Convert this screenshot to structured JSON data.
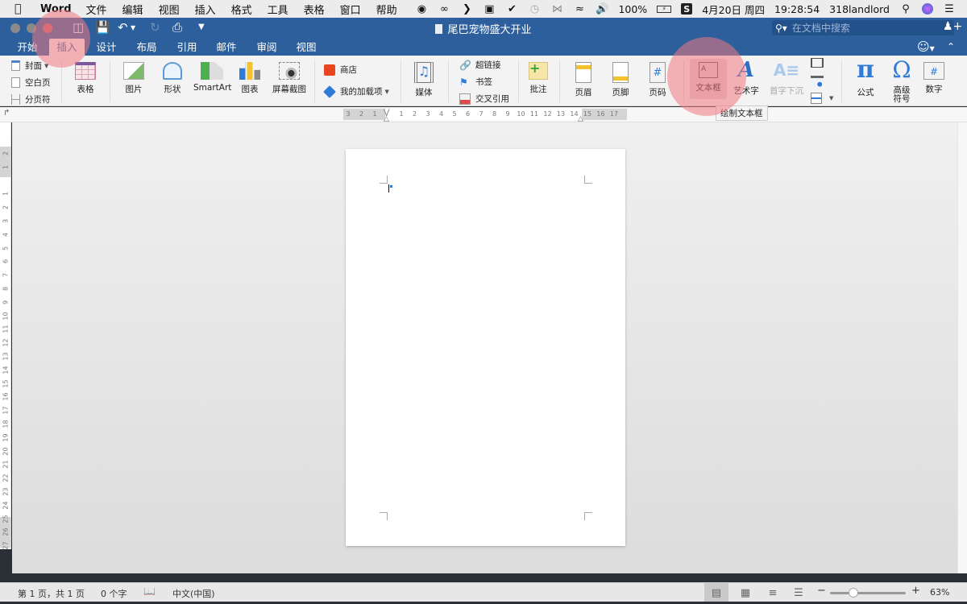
{
  "menubar": {
    "app_name": "Word",
    "menus": [
      "文件",
      "编辑",
      "视图",
      "插入",
      "格式",
      "工具",
      "表格",
      "窗口",
      "帮助"
    ],
    "status_icons": [
      "wechat-icon",
      "creative-cloud-icon",
      "evernote-icon",
      "airplay-icon",
      "checkmark-icon",
      "time-machine-icon",
      "bluetooth-icon",
      "wifi-icon",
      "volume-icon"
    ],
    "battery": "100%",
    "input_method": "S",
    "date": "4月20日 周四",
    "time": "19:28:54",
    "user": "318landlord"
  },
  "window": {
    "title": "尾巴宠物盛大开业",
    "search_placeholder": "在文档中搜索"
  },
  "tabs": [
    {
      "label": "开始"
    },
    {
      "label": "插入",
      "active": true
    },
    {
      "label": "设计"
    },
    {
      "label": "布局"
    },
    {
      "label": "引用"
    },
    {
      "label": "邮件"
    },
    {
      "label": "审阅"
    },
    {
      "label": "视图"
    }
  ],
  "ribbon": {
    "pages": {
      "cover": "封面",
      "blank": "空白页",
      "page_break": "分页符"
    },
    "table": "表格",
    "picture": "图片",
    "shapes": "形状",
    "smartart": "SmartArt",
    "chart": "图表",
    "screenshot": "屏幕截图",
    "store": "商店",
    "my_addins": "我的加载项",
    "media": "媒体",
    "hyperlink": "超链接",
    "bookmark": "书签",
    "cross_reference": "交叉引用",
    "comment": "批注",
    "header": "页眉",
    "footer": "页脚",
    "page_number": "页码",
    "text_box": "文本框",
    "wordart": "艺术字",
    "drop_cap": "首字下沉",
    "equation": "公式",
    "advanced_symbol_line1": "高级",
    "advanced_symbol_line2": "符号",
    "number": "数字",
    "equation_glyph": "π",
    "symbol_glyph": "Ω",
    "number_glyph": "#",
    "wordart_glyph": "A",
    "textbox_glyph": "A"
  },
  "tooltip": "绘制文本框",
  "ruler": {
    "horizontal": [
      "3",
      "2",
      "1",
      "",
      "1",
      "2",
      "3",
      "4",
      "5",
      "6",
      "7",
      "8",
      "9",
      "10",
      "11",
      "12",
      "13",
      "14",
      "15",
      "16",
      "17"
    ],
    "vertical": [
      "2",
      "1",
      "",
      "1",
      "2",
      "3",
      "4",
      "5",
      "6",
      "7",
      "8",
      "9",
      "10",
      "11",
      "12",
      "13",
      "14",
      "15",
      "16",
      "17",
      "18",
      "19",
      "20",
      "21",
      "22",
      "23",
      "24",
      "25",
      "26",
      "27"
    ]
  },
  "statusbar": {
    "page_info": "第 1 页，共 1 页",
    "word_count": "0 个字",
    "language": "中文(中国)",
    "zoom_level": "63%",
    "zoom_fraction": 0.31
  }
}
